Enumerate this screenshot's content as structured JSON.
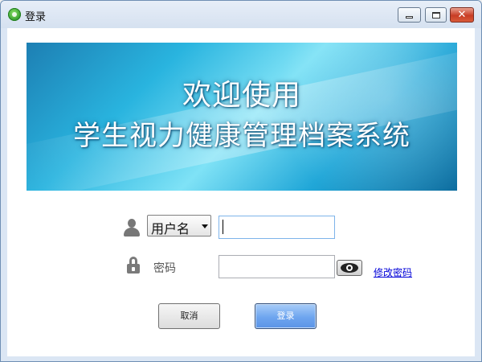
{
  "window": {
    "title": "登录",
    "controls": {
      "minimize_icon": "minimize-icon",
      "maximize_icon": "maximize-icon",
      "close_symbol": "✕"
    }
  },
  "banner": {
    "line1": "欢迎使用",
    "line2": "学生视力健康管理档案系统"
  },
  "form": {
    "account_type": {
      "selected": "用户名"
    },
    "username": {
      "value": ""
    },
    "password": {
      "label": "密码",
      "value": ""
    },
    "show_password_icon": "eye-icon",
    "change_password_link": "修改密码"
  },
  "buttons": {
    "cancel": "取消",
    "login": "登录"
  },
  "colors": {
    "accent": "#5b94e6",
    "link": "#0000d8",
    "close": "#c83d25"
  }
}
